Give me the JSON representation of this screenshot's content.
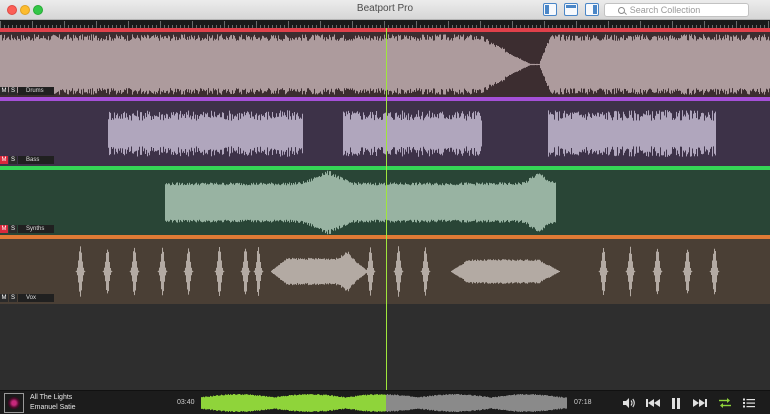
{
  "window": {
    "title": "Beatport Pro"
  },
  "search": {
    "placeholder": "Search Collection"
  },
  "tracks": [
    {
      "name": "Drums",
      "mute": "M",
      "solo": "S",
      "muted": false,
      "head_color": "#e0404a",
      "body_color": "#3c2d30",
      "wave_color": "#ad9b9d"
    },
    {
      "name": "Bass",
      "mute": "M",
      "solo": "S",
      "muted": true,
      "head_color": "#a550d8",
      "body_color": "#3d3248",
      "wave_color": "#b0a6bd"
    },
    {
      "name": "Synths",
      "mute": "M",
      "solo": "S",
      "muted": true,
      "head_color": "#35d556",
      "body_color": "#294536",
      "wave_color": "#98b3a2"
    },
    {
      "name": "Vox",
      "mute": "M",
      "solo": "S",
      "muted": false,
      "head_color": "#e07a35",
      "body_color": "#4a3f35",
      "wave_color": "#b3aaa3"
    }
  ],
  "player": {
    "title": "All The Lights",
    "artist": "Emanuel Satie",
    "elapsed": "03:40",
    "total": "07:18",
    "progress": 0.505,
    "played_color": "#8fd43a",
    "unplayed_color": "#8a8a8a"
  },
  "controls": {
    "volume": "speaker-icon",
    "previous": "skip-back-icon",
    "pause": "pause-icon",
    "next": "skip-forward-icon",
    "repeat": "repeat-shuffle-icon",
    "list": "list-icon"
  },
  "accent": "#9fe63c"
}
